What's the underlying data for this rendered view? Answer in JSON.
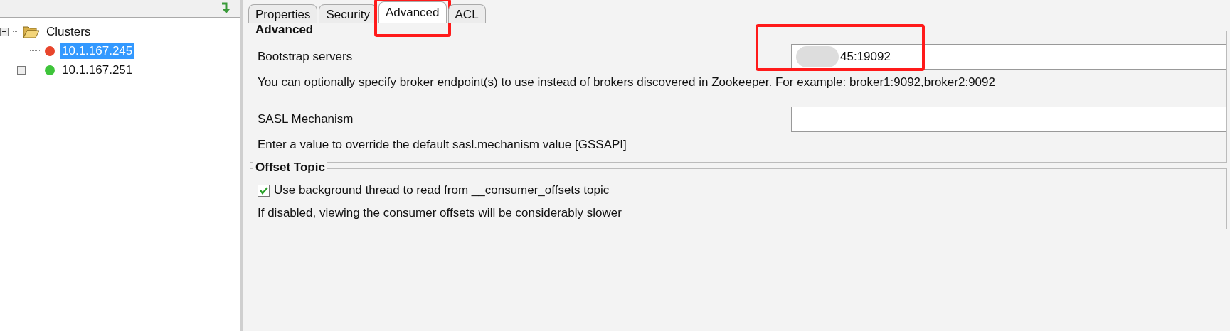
{
  "tree": [
    {
      "label": "Clusters",
      "kind": "folder",
      "expanded": true,
      "selected": false,
      "children": [
        {
          "label": "10.1.167.245",
          "kind": "server",
          "color": "#e8452c",
          "selected": true
        },
        {
          "label": "10.1.167.251",
          "kind": "server",
          "color": "#3ec43a",
          "selected": false,
          "children_hidden": true
        }
      ]
    }
  ],
  "tabs": [
    {
      "label": "Properties",
      "selected": false
    },
    {
      "label": "Security",
      "selected": false
    },
    {
      "label": "Advanced",
      "selected": true,
      "annotated": true
    },
    {
      "label": "ACL",
      "selected": false
    }
  ],
  "groups": [
    {
      "title": "Advanced",
      "items": [
        {
          "kind": "field",
          "label": "Bootstrap servers",
          "value": "45:19092",
          "redacted": true,
          "annotated": true,
          "help": "You can optionally specify broker endpoint(s) to use instead of brokers discovered in Zookeeper. For example: broker1:9092,broker2:9092"
        },
        {
          "kind": "field",
          "label": "SASL Mechanism",
          "value": "",
          "help": "Enter a value to override the default sasl.mechanism value [GSSAPI]"
        }
      ]
    },
    {
      "title": "Offset Topic",
      "items": [
        {
          "kind": "checkbox",
          "label": "Use background thread to read from __consumer_offsets topic",
          "checked": true,
          "help": "If disabled, viewing the consumer offsets will be considerably slower"
        }
      ]
    }
  ]
}
